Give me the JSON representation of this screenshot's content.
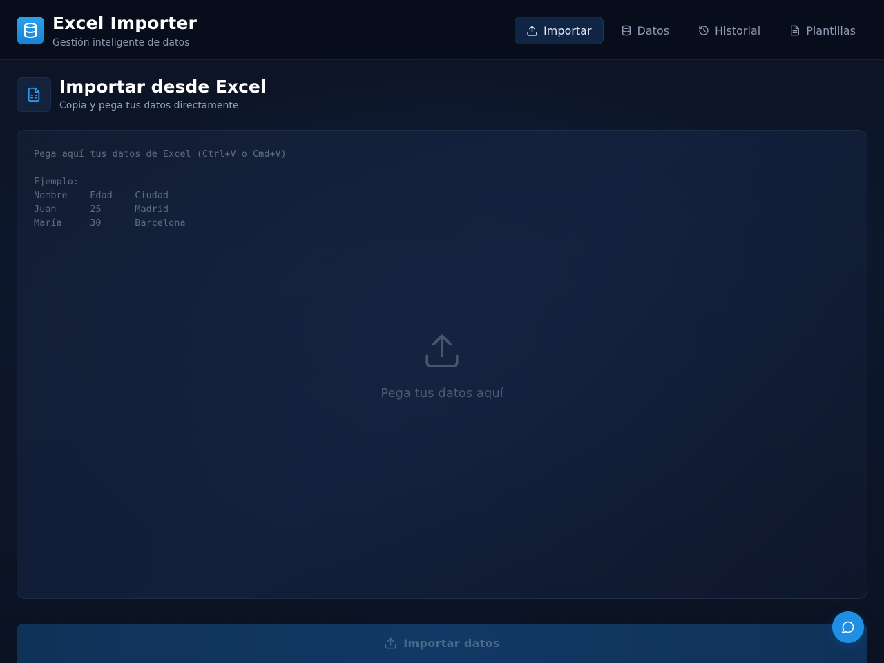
{
  "brand": {
    "title": "Excel Importer",
    "subtitle": "Gestión inteligente de datos",
    "icon": "database-icon"
  },
  "nav": {
    "items": [
      {
        "label": "Importar",
        "icon": "upload-icon",
        "active": true
      },
      {
        "label": "Datos",
        "icon": "database-icon",
        "active": false
      },
      {
        "label": "Historial",
        "icon": "history-icon",
        "active": false
      },
      {
        "label": "Plantillas",
        "icon": "file-text-icon",
        "active": false
      }
    ]
  },
  "section": {
    "title": "Importar desde Excel",
    "subtitle": "Copia y pega tus datos directamente",
    "icon": "spreadsheet-icon"
  },
  "paste": {
    "value": "",
    "placeholder": "Pega aquí tus datos de Excel (Ctrl+V o Cmd+V)\n\nEjemplo:\nNombre    Edad    Ciudad\nJuan      25      Madrid\nMaría     30      Barcelona",
    "hint": "Pega tus datos aquí"
  },
  "import_button": {
    "label": "Importar datos",
    "disabled": true
  },
  "colors": {
    "accent": "#1f8fe3",
    "background": "#0b1323",
    "header": "#070d1b"
  }
}
